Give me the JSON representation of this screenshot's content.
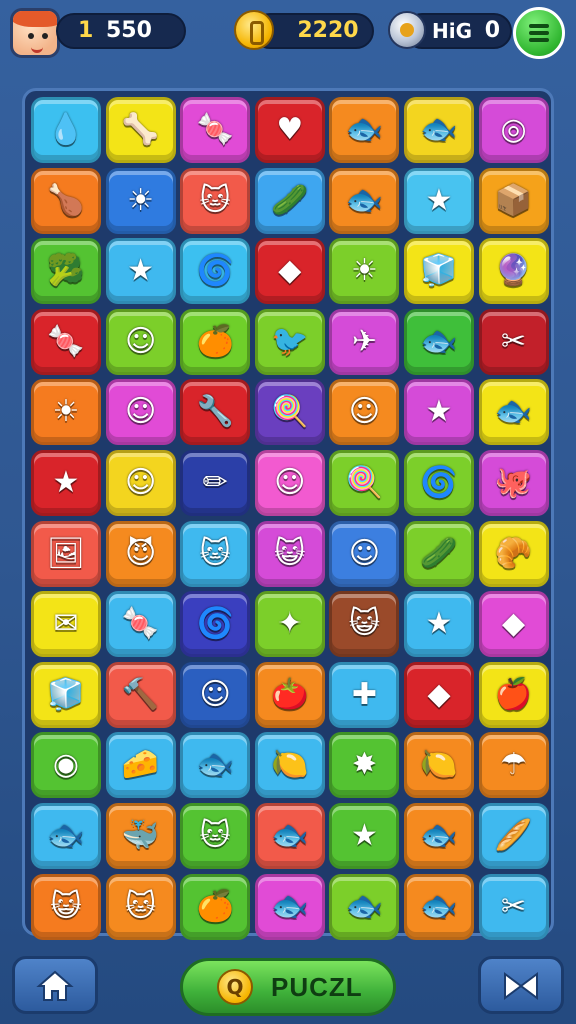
{
  "hud": {
    "avatar": "player-avatar",
    "level": "1",
    "score": "550",
    "coins": "2220",
    "hi_label": "HiG",
    "hi_value": "0",
    "menu_icon": "hamburger-menu-icon"
  },
  "board": {
    "rows": [
      [
        {
          "c": "#3cc0f0",
          "i": "💧",
          "n": "blob"
        },
        {
          "c": "#f3e417",
          "i": "🦴",
          "n": "bone"
        },
        {
          "c": "#e14bd6",
          "i": "🍬",
          "n": "candy"
        },
        {
          "c": "#d9242a",
          "i": "♥",
          "n": "heart"
        },
        {
          "c": "#f58a1f",
          "i": "🐟",
          "n": "fish"
        },
        {
          "c": "#f3d51f",
          "i": "🐟",
          "n": "fish"
        },
        {
          "c": "#d54bd8",
          "i": "◎",
          "n": "ring"
        }
      ],
      [
        {
          "c": "#f57b1f",
          "i": "🍗",
          "n": "drumstick"
        },
        {
          "c": "#2f7be0",
          "i": "☀",
          "n": "sun-face"
        },
        {
          "c": "#f25a4a",
          "i": "🐱",
          "n": "cat"
        },
        {
          "c": "#3ea6f0",
          "i": "🥒",
          "n": "cucumber"
        },
        {
          "c": "#f58a1f",
          "i": "🐟",
          "n": "fish"
        },
        {
          "c": "#48c3f0",
          "i": "★",
          "n": "star"
        },
        {
          "c": "#f5a21a",
          "i": "📦",
          "n": "box"
        }
      ],
      [
        {
          "c": "#54c332",
          "i": "🥦",
          "n": "broccoli"
        },
        {
          "c": "#3fb9ef",
          "i": "★",
          "n": "starfish"
        },
        {
          "c": "#3cc0f0",
          "i": "🌀",
          "n": "swirl"
        },
        {
          "c": "#d9242a",
          "i": "◆",
          "n": "crystal"
        },
        {
          "c": "#7ccf2a",
          "i": "☀",
          "n": "sun"
        },
        {
          "c": "#f3e417",
          "i": "🧊",
          "n": "cube"
        },
        {
          "c": "#f3e417",
          "i": "🔮",
          "n": "orb"
        }
      ],
      [
        {
          "c": "#d9242a",
          "i": "🍬",
          "n": "candy"
        },
        {
          "c": "#7ccf2a",
          "i": "☺",
          "n": "smiley"
        },
        {
          "c": "#6fcf2a",
          "i": "🍊",
          "n": "orange"
        },
        {
          "c": "#7ccf2a",
          "i": "🐦",
          "n": "bird"
        },
        {
          "c": "#d54bd8",
          "i": "✈",
          "n": "plane"
        },
        {
          "c": "#3fbf3a",
          "i": "🐟",
          "n": "fish"
        },
        {
          "c": "#c2202a",
          "i": "✂",
          "n": "crossed"
        }
      ],
      [
        {
          "c": "#f57b1f",
          "i": "☀",
          "n": "sun"
        },
        {
          "c": "#e14bd6",
          "i": "☺",
          "n": "blob-face"
        },
        {
          "c": "#d9242a",
          "i": "🔧",
          "n": "tool"
        },
        {
          "c": "#6a3fbf",
          "i": "🍭",
          "n": "lollipop"
        },
        {
          "c": "#f58a1f",
          "i": "☺",
          "n": "green-face"
        },
        {
          "c": "#d54bd8",
          "i": "★",
          "n": "star"
        },
        {
          "c": "#f3e417",
          "i": "🐟",
          "n": "fish"
        }
      ],
      [
        {
          "c": "#d9242a",
          "i": "★",
          "n": "starfish"
        },
        {
          "c": "#f3d51f",
          "i": "☺",
          "n": "face"
        },
        {
          "c": "#2b3fa8",
          "i": "✏",
          "n": "crayon"
        },
        {
          "c": "#f25ad0",
          "i": "☺",
          "n": "blue-face"
        },
        {
          "c": "#7ccf2a",
          "i": "🍭",
          "n": "lollipop"
        },
        {
          "c": "#7ccf2a",
          "i": "🌀",
          "n": "snail"
        },
        {
          "c": "#d54bd8",
          "i": "🐙",
          "n": "octopus"
        }
      ],
      [
        {
          "c": "#f25a4a",
          "i": "🖼",
          "n": "picture"
        },
        {
          "c": "#f58a1f",
          "i": "😈",
          "n": "devil"
        },
        {
          "c": "#3fb9ef",
          "i": "🐱",
          "n": "cat"
        },
        {
          "c": "#d54bd8",
          "i": "😺",
          "n": "cat-face"
        },
        {
          "c": "#3c7fe0",
          "i": "☺",
          "n": "purple-face"
        },
        {
          "c": "#7ccf2a",
          "i": "🥒",
          "n": "cucumber"
        },
        {
          "c": "#f3e417",
          "i": "🥐",
          "n": "croissant"
        }
      ],
      [
        {
          "c": "#f3e417",
          "i": "✉",
          "n": "envelope"
        },
        {
          "c": "#3fb9ef",
          "i": "🍬",
          "n": "candy"
        },
        {
          "c": "#3a3fbf",
          "i": "🌀",
          "n": "swirl"
        },
        {
          "c": "#7ccf2a",
          "i": "✦",
          "n": "star4"
        },
        {
          "c": "#9a4a2a",
          "i": "😺",
          "n": "cat-face"
        },
        {
          "c": "#3fb9ef",
          "i": "★",
          "n": "burst"
        },
        {
          "c": "#e14bd6",
          "i": "◆",
          "n": "gem"
        }
      ],
      [
        {
          "c": "#f3e417",
          "i": "🧊",
          "n": "cube"
        },
        {
          "c": "#f25a4a",
          "i": "🔨",
          "n": "hammer"
        },
        {
          "c": "#2b5fc0",
          "i": "☺",
          "n": "brown-face"
        },
        {
          "c": "#f58a1f",
          "i": "🍅",
          "n": "tomato"
        },
        {
          "c": "#3fb9ef",
          "i": "✚",
          "n": "puzzle"
        },
        {
          "c": "#d9242a",
          "i": "◆",
          "n": "crystal"
        },
        {
          "c": "#f3e417",
          "i": "🍎",
          "n": "apple"
        }
      ],
      [
        {
          "c": "#54c332",
          "i": "◉",
          "n": "swirl-orb"
        },
        {
          "c": "#3fb9ef",
          "i": "🧀",
          "n": "cheese"
        },
        {
          "c": "#3fb9ef",
          "i": "🐟",
          "n": "fish"
        },
        {
          "c": "#3fb9ef",
          "i": "🍋",
          "n": "lemon"
        },
        {
          "c": "#54c332",
          "i": "✸",
          "n": "splat"
        },
        {
          "c": "#f58a1f",
          "i": "🍋",
          "n": "lemon"
        },
        {
          "c": "#f58a1f",
          "i": "☂",
          "n": "mushroom"
        }
      ],
      [
        {
          "c": "#3fb9ef",
          "i": "🐟",
          "n": "fish"
        },
        {
          "c": "#f58a1f",
          "i": "🐳",
          "n": "whale"
        },
        {
          "c": "#54c332",
          "i": "🐱",
          "n": "cat"
        },
        {
          "c": "#f25a4a",
          "i": "🐟",
          "n": "fish"
        },
        {
          "c": "#54c332",
          "i": "★",
          "n": "star"
        },
        {
          "c": "#f58a1f",
          "i": "🐟",
          "n": "fish"
        },
        {
          "c": "#3fb9ef",
          "i": "🥖",
          "n": "bread"
        }
      ],
      [
        {
          "c": "#f57b1f",
          "i": "😺",
          "n": "cat-face"
        },
        {
          "c": "#f58a1f",
          "i": "🐱",
          "n": "cat"
        },
        {
          "c": "#54c332",
          "i": "🍊",
          "n": "orange"
        },
        {
          "c": "#e14bd6",
          "i": "🐟",
          "n": "fish"
        },
        {
          "c": "#7ccf2a",
          "i": "🐟",
          "n": "fish"
        },
        {
          "c": "#f58a1f",
          "i": "🐟",
          "n": "fish"
        },
        {
          "c": "#3fb9ef",
          "i": "✂",
          "n": "crossed"
        }
      ]
    ]
  },
  "bottom": {
    "home_icon": "home-icon",
    "puzzle_label": "PUCZL",
    "puzzle_badge": "Q",
    "swap_icon": "swap-icon"
  }
}
